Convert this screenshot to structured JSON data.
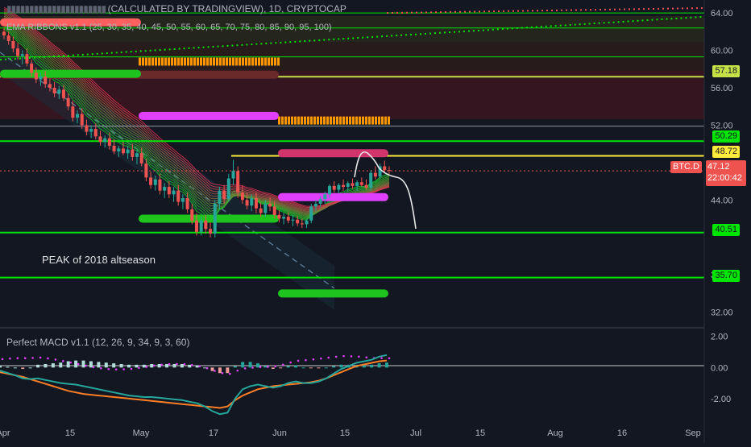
{
  "header": {
    "main_title": "(CALCULATED BY TRADINGVIEW), 1D, CRYPTOCAP",
    "ema_indicator": "EMA RIBBONS v1.1 (25, 30, 35, 40, 45, 50, 55, 60, 65, 70, 75, 80, 85, 90, 95, 100)",
    "macd_indicator": "Perfect MACD v1.1 (12, 26, 9, 34, 9, 3, 60)"
  },
  "annotation": "PEAK of 2018 altseason",
  "colors": {
    "background": "#131722",
    "up": "#26a69a",
    "down": "#ef5350",
    "green_level": "#00e600",
    "yellow_level": "#ffeb3b",
    "magenta_zone": "#e040fb",
    "orange_zone": "#ff9800",
    "macd_line": "#26a69a",
    "signal_line": "#ff7f27",
    "macd_dots": "#e040fb"
  },
  "price_axis": {
    "ticks": [
      "64.00",
      "60.00",
      "56.00",
      "52.00",
      "44.00",
      "36.00",
      "32.00"
    ],
    "range": [
      30.5,
      64.7
    ]
  },
  "macd_axis": {
    "ticks": [
      "2.00",
      "0.00",
      "-2.00"
    ],
    "range": [
      -3.3,
      2.4
    ]
  },
  "time_axis": {
    "ticks": [
      "Apr",
      "15",
      "May",
      "17",
      "Jun",
      "15",
      "Jul",
      "15",
      "Aug",
      "16",
      "Sep"
    ]
  },
  "price_labels": {
    "l5718": "57.18",
    "l5029": "50.29",
    "l4872": "48.72",
    "symbol": "BTC.D",
    "current": "47.12",
    "countdown": "22:00:42",
    "l4051": "40.51",
    "l3570": "35.70"
  },
  "chart_data": [
    {
      "type": "candlestick",
      "title": "(CALCULATED BY TRADINGVIEW), 1D, CRYPTOCAP",
      "symbol": "BTC.D",
      "x_start": "2018-04-01",
      "y_range": [
        30.5,
        64.7
      ],
      "ohlc": [
        [
          62.0,
          62.4,
          61.2,
          61.6
        ],
        [
          61.6,
          62.0,
          60.6,
          61.0
        ],
        [
          61.0,
          61.5,
          59.8,
          60.2
        ],
        [
          60.2,
          60.8,
          59.0,
          59.4
        ],
        [
          59.4,
          60.0,
          58.5,
          59.6
        ],
        [
          59.6,
          60.2,
          58.3,
          58.6
        ],
        [
          58.6,
          59.0,
          57.2,
          57.6
        ],
        [
          57.6,
          58.2,
          56.5,
          56.9
        ],
        [
          56.9,
          57.6,
          56.2,
          57.2
        ],
        [
          57.2,
          57.8,
          56.0,
          56.4
        ],
        [
          56.4,
          57.0,
          55.6,
          56.0
        ],
        [
          56.0,
          56.6,
          55.0,
          55.4
        ],
        [
          55.4,
          56.2,
          54.8,
          55.8
        ],
        [
          55.8,
          56.3,
          54.6,
          54.9
        ],
        [
          54.9,
          55.4,
          53.6,
          54.0
        ],
        [
          54.0,
          54.6,
          52.4,
          52.8
        ],
        [
          52.8,
          53.6,
          52.2,
          53.2
        ],
        [
          53.2,
          53.8,
          51.6,
          52.0
        ],
        [
          52.0,
          52.6,
          50.9,
          51.3
        ],
        [
          51.3,
          52.0,
          50.6,
          51.6
        ],
        [
          51.6,
          52.2,
          50.5,
          50.8
        ],
        [
          50.8,
          51.4,
          49.8,
          50.2
        ],
        [
          50.2,
          50.9,
          49.6,
          50.6
        ],
        [
          50.6,
          51.2,
          49.4,
          49.8
        ],
        [
          49.8,
          50.5,
          48.9,
          49.2
        ],
        [
          49.2,
          49.8,
          48.6,
          49.5
        ],
        [
          49.5,
          50.2,
          48.8,
          49.0
        ],
        [
          49.0,
          49.8,
          48.4,
          49.4
        ],
        [
          49.4,
          50.0,
          48.2,
          48.6
        ],
        [
          48.6,
          49.4,
          47.8,
          49.0
        ],
        [
          49.0,
          49.6,
          47.6,
          47.9
        ],
        [
          47.9,
          48.4,
          46.0,
          46.4
        ],
        [
          46.4,
          47.0,
          45.2,
          45.6
        ],
        [
          45.6,
          46.6,
          45.0,
          46.2
        ],
        [
          46.2,
          46.8,
          44.6,
          45.0
        ],
        [
          45.0,
          45.8,
          44.2,
          45.4
        ],
        [
          45.4,
          46.0,
          44.2,
          44.6
        ],
        [
          44.6,
          45.4,
          43.8,
          45.0
        ],
        [
          45.0,
          45.6,
          43.4,
          43.8
        ],
        [
          43.8,
          44.6,
          43.0,
          44.2
        ],
        [
          44.2,
          44.8,
          42.6,
          43.0
        ],
        [
          43.0,
          43.6,
          41.4,
          41.8
        ],
        [
          41.8,
          42.6,
          40.2,
          40.6
        ],
        [
          40.6,
          42.2,
          40.2,
          41.8
        ],
        [
          41.8,
          42.4,
          40.4,
          40.9
        ],
        [
          40.9,
          41.6,
          40.0,
          40.4
        ],
        [
          40.4,
          44.0,
          40.0,
          43.6
        ],
        [
          43.6,
          45.4,
          43.0,
          45.0
        ],
        [
          45.0,
          45.6,
          43.6,
          44.1
        ],
        [
          44.1,
          46.8,
          43.8,
          46.3
        ],
        [
          46.3,
          48.3,
          45.6,
          47.1
        ],
        [
          47.1,
          47.6,
          44.2,
          44.8
        ],
        [
          44.8,
          45.6,
          43.6,
          44.0
        ],
        [
          44.0,
          44.8,
          43.0,
          43.4
        ],
        [
          43.4,
          44.6,
          42.8,
          44.2
        ],
        [
          44.2,
          44.8,
          42.6,
          43.1
        ],
        [
          43.1,
          43.7,
          42.2,
          42.6
        ],
        [
          42.6,
          44.0,
          42.2,
          43.6
        ],
        [
          43.6,
          44.3,
          42.8,
          43.3
        ],
        [
          43.3,
          43.9,
          42.0,
          42.4
        ],
        [
          42.4,
          42.9,
          41.6,
          42.0
        ],
        [
          42.0,
          42.6,
          41.4,
          42.2
        ],
        [
          42.2,
          42.7,
          41.5,
          41.8
        ],
        [
          41.8,
          42.4,
          41.2,
          41.9
        ],
        [
          41.9,
          42.3,
          41.2,
          41.5
        ],
        [
          41.5,
          42.0,
          41.0,
          41.4
        ],
        [
          41.4,
          42.0,
          41.0,
          41.8
        ],
        [
          41.8,
          43.6,
          41.5,
          43.3
        ],
        [
          43.3,
          44.0,
          42.8,
          43.6
        ],
        [
          43.6,
          44.4,
          43.2,
          44.1
        ],
        [
          44.1,
          44.9,
          43.6,
          44.6
        ],
        [
          44.6,
          45.7,
          44.2,
          45.5
        ],
        [
          45.5,
          46.0,
          44.8,
          45.1
        ],
        [
          45.1,
          45.8,
          44.7,
          45.6
        ],
        [
          45.6,
          46.2,
          45.0,
          45.4
        ],
        [
          45.4,
          46.0,
          44.9,
          45.8
        ],
        [
          45.8,
          46.3,
          45.2,
          45.5
        ],
        [
          45.5,
          46.1,
          45.0,
          45.9
        ],
        [
          45.9,
          46.4,
          45.4,
          45.6
        ],
        [
          45.6,
          46.2,
          45.1,
          45.3
        ],
        [
          45.3,
          47.2,
          45.0,
          46.9
        ],
        [
          46.9,
          47.6,
          46.2,
          46.5
        ],
        [
          46.5,
          47.9,
          46.3,
          47.6
        ],
        [
          47.6,
          48.2,
          46.9,
          47.2
        ],
        [
          47.2,
          47.6,
          46.8,
          47.12
        ]
      ]
    },
    {
      "type": "line",
      "title": "Perfect MACD v1.1 (12, 26, 9, 34, 9, 3, 60)",
      "y_range": [
        -3.3,
        2.4
      ],
      "series": [
        {
          "values": [
            -0.2,
            -0.35,
            -0.5,
            -0.7,
            -0.75,
            -0.7,
            -0.8,
            -0.9,
            -1.0,
            -1.05,
            -1.1,
            -1.2,
            -1.3,
            -1.4,
            -1.5,
            -1.6,
            -1.7,
            -1.8,
            -1.85,
            -1.9,
            -1.9,
            -1.95,
            -2.0,
            -2.05,
            -2.1,
            -2.2,
            -2.3,
            -2.5,
            -2.8,
            -3.0,
            -2.9,
            -2.0,
            -1.4,
            -1.2,
            -1.1,
            -1.2,
            -1.3,
            -1.2,
            -1.0,
            -0.9,
            -1.0,
            -1.0,
            -0.9,
            -0.7,
            -0.4,
            -0.1,
            0.1,
            0.3,
            0.4,
            0.5,
            0.7,
            0.8
          ]
        },
        {
          "values": [
            -0.3,
            -0.4,
            -0.5,
            -0.6,
            -0.75,
            -0.9,
            -1.05,
            -1.2,
            -1.35,
            -1.5,
            -1.6,
            -1.7,
            -1.75,
            -1.8,
            -1.85,
            -1.9,
            -1.95,
            -2.0,
            -2.05,
            -2.1,
            -2.15,
            -2.2,
            -2.25,
            -2.3,
            -2.35,
            -2.4,
            -2.45,
            -2.5,
            -2.55,
            -2.6,
            -2.5,
            -2.1,
            -1.8,
            -1.6,
            -1.4,
            -1.3,
            -1.2,
            -1.15,
            -1.1,
            -1.05,
            -1.0,
            -0.95,
            -0.85,
            -0.7,
            -0.5,
            -0.3,
            -0.1,
            0.1,
            0.2,
            0.3,
            0.4,
            0.45
          ]
        }
      ]
    }
  ]
}
